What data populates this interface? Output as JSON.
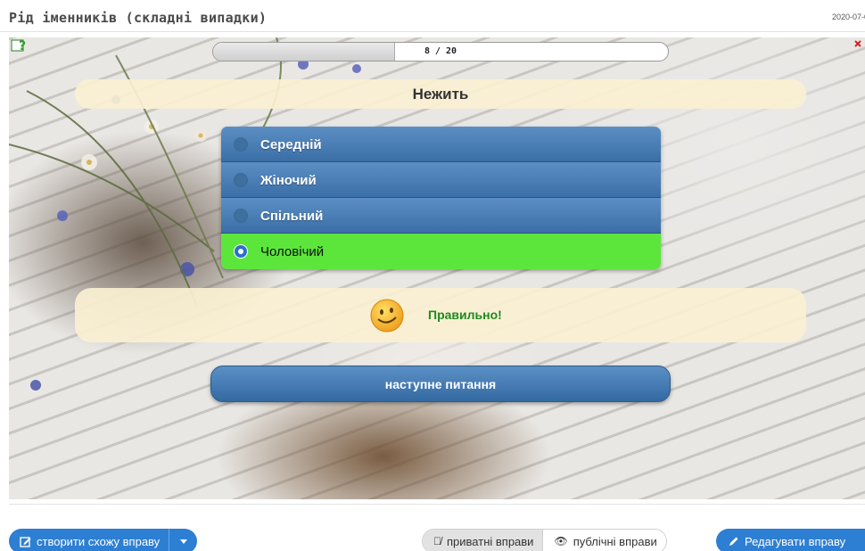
{
  "header": {
    "title": "Рід іменників (складні випадки)",
    "date": "2020-07-0"
  },
  "quiz": {
    "progress": {
      "label": "8 / 20",
      "current": 8,
      "total": 20
    },
    "question": "Нежить",
    "options": [
      {
        "label": "Середній",
        "selected": false
      },
      {
        "label": "Жіночий",
        "selected": false
      },
      {
        "label": "Спільний",
        "selected": false
      },
      {
        "label": "Чоловічий",
        "selected": true
      }
    ],
    "feedback": "Правильно!",
    "next_label": "наступне питання"
  },
  "footer": {
    "create_similar": "створити схожу вправу",
    "private_toggle": "приватні вправи",
    "public_toggle": "публічні вправи",
    "edit_exercise": "Редагувати вправу"
  },
  "colors": {
    "accent": "#2d7fd3",
    "option_bg": "#4a7fb5",
    "correct_bg": "#5ce63c",
    "feedback_text": "#1e8a1e"
  },
  "icons": [
    "help-icon",
    "close-icon",
    "smiley-icon",
    "edit-icon",
    "caret-down-icon",
    "eye-slash-icon",
    "eye-icon",
    "pencil-icon"
  ]
}
